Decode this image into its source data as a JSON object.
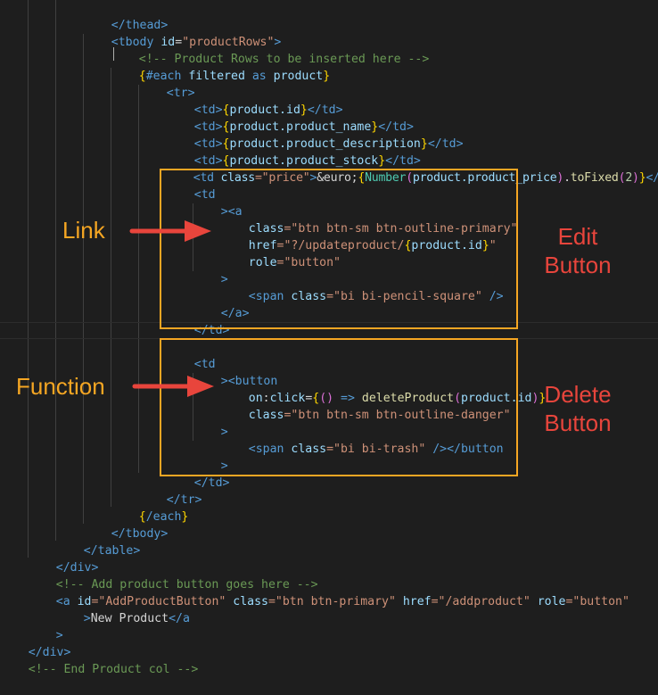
{
  "code": {
    "thead_close": "</thead>",
    "tbody_open": {
      "tag": "<tbody",
      "attr": "id",
      "eq": "=",
      "val": "\"productRows\"",
      "close": ">"
    },
    "comment_rows": "<!-- Product Rows to be inserted here -->",
    "each_open": {
      "b1": "{",
      "kw": "#each",
      "rest": " filtered ",
      "as": "as",
      "var": " product",
      "b2": "}"
    },
    "tr_open": "<tr>",
    "td_id": {
      "open": "<td>",
      "b1": "{",
      "expr": "product.id",
      "b2": "}",
      "close": "</td>"
    },
    "td_name": {
      "open": "<td>",
      "b1": "{",
      "expr": "product.product_name",
      "b2": "}",
      "close": "</td>"
    },
    "td_desc": {
      "open": "<td>",
      "b1": "{",
      "expr": "product.product_description",
      "b2": "}",
      "close": "</td>"
    },
    "td_stock": {
      "open": "<td>",
      "b1": "{",
      "expr": "product.product_stock",
      "b2": "}",
      "close": "</td>"
    },
    "td_price": {
      "open": "<td",
      "attr": " class",
      "val": "=\"price\"",
      "gt": ">",
      "entity": "&euro;",
      "b1": "{",
      "fn": "Number",
      "p1": "(",
      "expr": "product.product_price",
      "p2": ")",
      "dot": ".",
      "method": "toFixed",
      "p3": "(",
      "num": "2",
      "p4": ")",
      "b2": "}",
      "close": "</td>"
    },
    "td_open": "<td",
    "a_open": "><a",
    "a_class": {
      "attr": "class",
      "val": "=\"btn btn-sm btn-outline-primary\""
    },
    "a_href": {
      "attr": "href",
      "val": "=\"?/updateproduct/",
      "b1": "{",
      "expr": "product.id",
      "b2": "}",
      "q": "\""
    },
    "a_role": {
      "attr": "role",
      "val": "=\"button\""
    },
    "gt": ">",
    "span_pencil": {
      "tag": "<span",
      "attr": " class",
      "val": "=\"bi bi-pencil-square\"",
      "end": " />"
    },
    "a_close": "</a>",
    "td_close": "</td>",
    "td_open2": "<td",
    "button_open": "><button",
    "onclick": {
      "ns": "on",
      "colon": ":",
      "ev": "click",
      "eq": "=",
      "b1": "{",
      "p1": "()",
      "arrow": " => ",
      "fn": "deleteProduct",
      "p2": "(",
      "expr": "product.id",
      "p3": ")",
      "b2": "}"
    },
    "button_class": {
      "attr": "class",
      "val": "=\"btn btn-sm btn-outline-danger\""
    },
    "gt2": ">",
    "span_trash": {
      "tag": "<span",
      "attr": " class",
      "val": "=\"bi bi-trash\"",
      "end": " />",
      "close": "</button"
    },
    "gt3": ">",
    "td_close2": "</td>",
    "tr_close": "</tr>",
    "each_close": {
      "b1": "{",
      "kw": "/each",
      "b2": "}"
    },
    "tbody_close": "</tbody>",
    "table_close": "</table>",
    "div_close": "</div>",
    "comment_add": "<!-- Add product button goes here -->",
    "add_button": {
      "tag": "<a",
      "a1": " id",
      "v1": "=\"AddProductButton\"",
      "a2": " class",
      "v2": "=\"btn btn-primary\"",
      "a3": " href",
      "v3": "=\"/addproduct\"",
      "a4": " role",
      "v4": "=\"button\""
    },
    "add_text": {
      "gt": ">",
      "text": "New Product",
      "close": "</a"
    },
    "gt4": ">",
    "div_close2": "</div>",
    "comment_end": "<!-- End Product col -->"
  },
  "annotations": {
    "link_label": "Link",
    "function_label": "Function",
    "edit_label_1": "Edit",
    "edit_label_2": "Button",
    "delete_label_1": "Delete",
    "delete_label_2": "Button"
  },
  "colors": {
    "background": "#1e1e1e",
    "highlight_box": "#f5a623",
    "label_orange": "#f5a623",
    "label_red": "#e8453c",
    "arrow": "#e8453c"
  }
}
